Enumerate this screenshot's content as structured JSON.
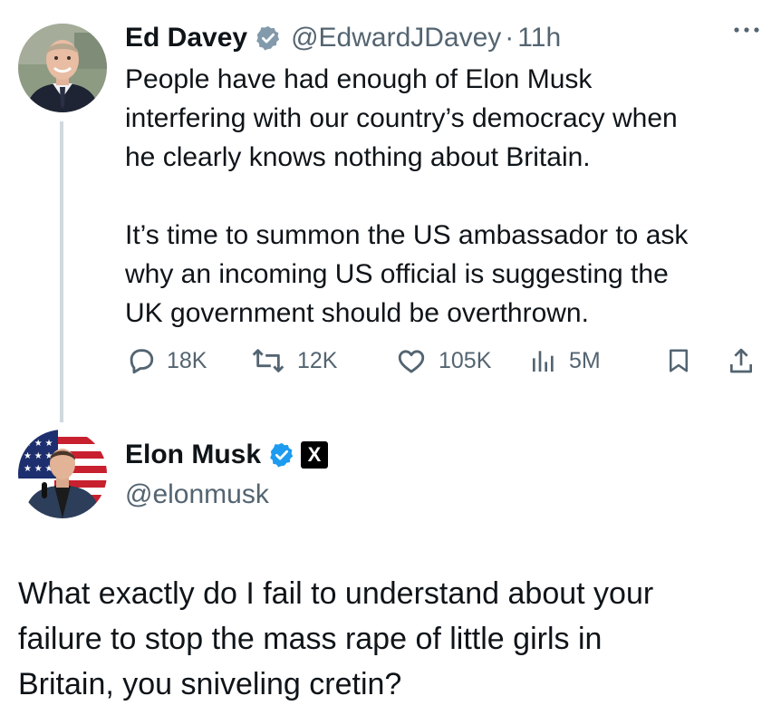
{
  "tweet1": {
    "author_name": "Ed Davey",
    "handle": "@EdwardJDavey",
    "separator": "·",
    "time": "11h",
    "text_p1": "People have had enough of Elon Musk\ninterfering with our country’s democracy when\nhe clearly knows nothing about Britain.",
    "text_p2": "It’s time to summon the US ambassador to ask\nwhy an incoming US official is suggesting the\nUK government should be overthrown.",
    "stats": {
      "replies": "18K",
      "reposts": "12K",
      "likes": "105K",
      "views": "5M"
    },
    "verified_color": "#829aab"
  },
  "tweet2": {
    "author_name": "Elon Musk",
    "handle": "@elonmusk",
    "text": "What exactly do I fail to understand about your\nfailure to stop the mass rape of little girls in\nBritain, you sniveling cretin?",
    "verified_color": "#1d9bf0",
    "affiliate_badge": "X"
  },
  "icons": {
    "more": "more-horizontal-icon",
    "reply": "reply-icon",
    "repost": "repost-icon",
    "like": "heart-icon",
    "views": "analytics-icon",
    "bookmark": "bookmark-icon",
    "share": "share-icon"
  },
  "colors": {
    "text": "#0f1419",
    "secondary": "#536471",
    "thread_line": "#cfd9de"
  }
}
